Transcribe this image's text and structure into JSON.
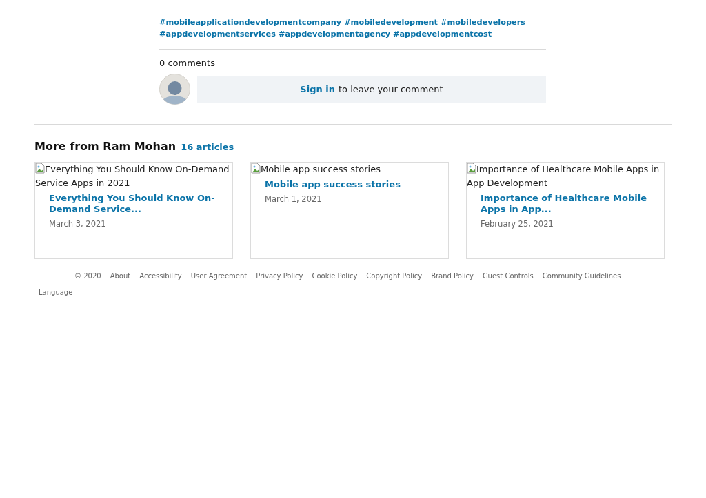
{
  "hashtags": [
    "#mobileapplicationdevelopmentcompany",
    "#mobiledevelopment",
    "#mobiledevelopers",
    "#appdevelopmentservices",
    "#appdevelopmentagency",
    "#appdevelopmentcost"
  ],
  "comments": {
    "count": "0 comments",
    "sign_in": "Sign in",
    "prompt": "to leave your comment"
  },
  "more": {
    "title": "More from Ram Mohan",
    "count": "16 articles"
  },
  "articles": [
    {
      "image_alt": "Everything You Should Know On-Demand Service Apps in 2021",
      "title": "Everything You Should Know On-Demand Service...",
      "date": "March 3, 2021"
    },
    {
      "image_alt": "Mobile app success stories",
      "title": "Mobile app success stories",
      "date": "March 1, 2021"
    },
    {
      "image_alt": "Importance of Healthcare Mobile Apps in App Development",
      "title": "Importance of Healthcare Mobile Apps in App...",
      "date": "February 25, 2021"
    }
  ],
  "footer": {
    "links": [
      "© 2020",
      "About",
      "Accessibility",
      "User Agreement",
      "Privacy Policy",
      "Cookie Policy",
      "Copyright Policy",
      "Brand Policy",
      "Guest Controls",
      "Community Guidelines"
    ],
    "language": "Language"
  }
}
